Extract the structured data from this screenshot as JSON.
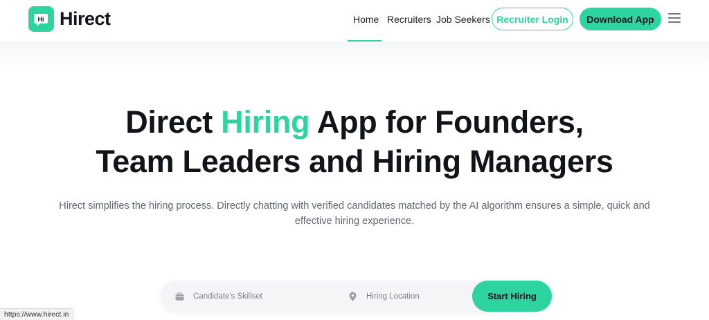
{
  "brand": {
    "name": "Hirect",
    "accent_color": "#2dd4a0",
    "logo_icon": "hi-chat-bubble-icon"
  },
  "nav": {
    "links": [
      "Home",
      "Recruiters",
      "Job Seekers"
    ],
    "active": "Home",
    "recruiter_login": "Recruiter Login",
    "download_app": "Download App",
    "menu_icon": "hamburger-menu-icon"
  },
  "hero": {
    "title_part1": "Direct ",
    "title_accent": "Hiring",
    "title_part2": " App for Founders,",
    "title_line2": "Team Leaders and Hiring Managers",
    "description_line1": "Hirect simplifies the hiring process. Directly chatting with verified candidates matched by the AI algorithm ensures a simple, quick and",
    "description_line2": "effective hiring experience."
  },
  "search": {
    "skillset_placeholder": "Candidate's Skillset",
    "skillset_icon": "briefcase-icon",
    "location_placeholder": "Hiring Location",
    "location_icon": "location-pin-icon",
    "submit_label": "Start Hiring"
  },
  "status_bar": {
    "url": "https://www.hirect.in"
  }
}
